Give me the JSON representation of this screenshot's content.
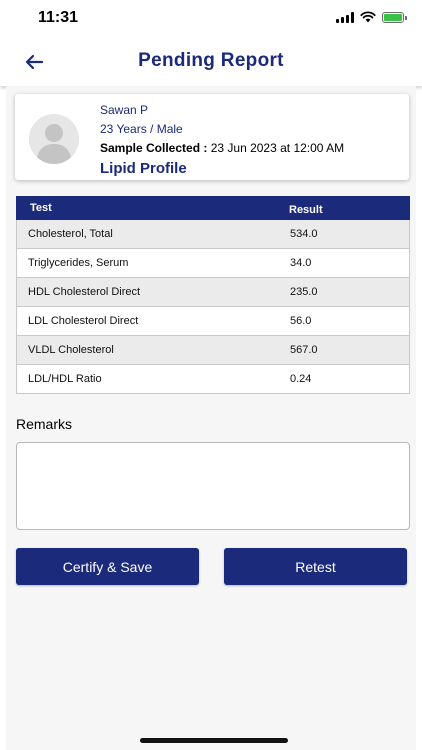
{
  "status_bar": {
    "time": "11:31",
    "icons": [
      "signal-icon",
      "wifi-icon",
      "battery-charging-icon"
    ]
  },
  "header": {
    "back_icon": "arrow-left-icon",
    "title": "Pending Report"
  },
  "patient": {
    "avatar_icon": "user-avatar-icon",
    "name": "Sawan P",
    "age_gender": "23 Years / Male",
    "sample_label": "Sample Collected :",
    "sample_value": "23 Jun 2023 at 12:00 AM",
    "profile": "Lipid Profile"
  },
  "table": {
    "headers": {
      "test": "Test",
      "result": "Result"
    },
    "rows": [
      {
        "test": "Cholesterol, Total",
        "result": "534.0"
      },
      {
        "test": "Triglycerides, Serum",
        "result": "34.0"
      },
      {
        "test": "HDL Cholesterol Direct",
        "result": "235.0"
      },
      {
        "test": "LDL Cholesterol Direct",
        "result": "56.0"
      },
      {
        "test": "VLDL Cholesterol",
        "result": "567.0"
      },
      {
        "test": "LDL/HDL Ratio",
        "result": "0.24"
      }
    ]
  },
  "remarks": {
    "label": "Remarks",
    "value": ""
  },
  "actions": {
    "certify_label": "Certify & Save",
    "retest_label": "Retest"
  },
  "colors": {
    "primary": "#1b2a7a",
    "row_alt": "#ebebeb",
    "battery": "#39c24a"
  }
}
